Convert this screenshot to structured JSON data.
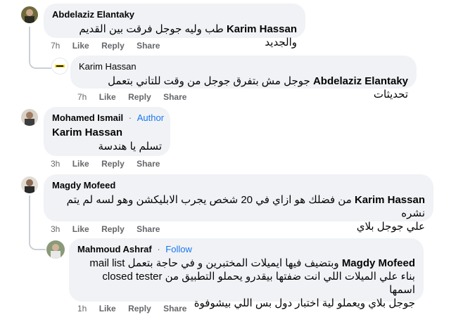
{
  "comments": [
    {
      "author": "Abdelaziz Elantaky",
      "tag": "Karim Hassan",
      "text": "طب وليه جوجل فرقت بين القديم والجديد",
      "time": "7h",
      "like": "Like",
      "reply": "Reply",
      "share": "Share"
    },
    {
      "author": "Karim Hassan",
      "tag": "Abdelaziz Elantaky",
      "text": "جوجل مش بتفرق جوجل من وقت للتاني بتعمل تحديثات",
      "time": "7h",
      "like": "Like",
      "reply": "Reply",
      "share": "Share"
    },
    {
      "author": "Mohamed Ismail",
      "badge": "Author",
      "tag": "Karim Hassan",
      "text": "تسلم يا هندسة",
      "time": "3h",
      "like": "Like",
      "reply": "Reply",
      "share": "Share"
    },
    {
      "author": "Magdy Mofeed",
      "tag": "Karim Hassan",
      "text": "من فضلك هو ازاي في 20 شخص يجرب الابليكشن وهو لسه لم يتم نشره",
      "text2": "علي جوجل بلاي",
      "time": "3h",
      "like": "Like",
      "reply": "Reply",
      "share": "Share"
    },
    {
      "author": "Mahmoud Ashraf",
      "follow": "Follow",
      "tag": "Magdy Mofeed",
      "line1": "وبتضيف فيها ايميلات المختبرين و في حاجة بتعمل mail list",
      "line2": "بناء علي الميلات اللي انت ضفتها بيقدرو يحملو التطبيق من closed tester اسمها",
      "line3": "جوجل بلاي ويعملو لية اختبار دول بس اللي بيشوفوة",
      "time": "1h",
      "like": "Like",
      "reply": "Reply",
      "share": "Share"
    }
  ],
  "logo_text": "Karim Hassan"
}
